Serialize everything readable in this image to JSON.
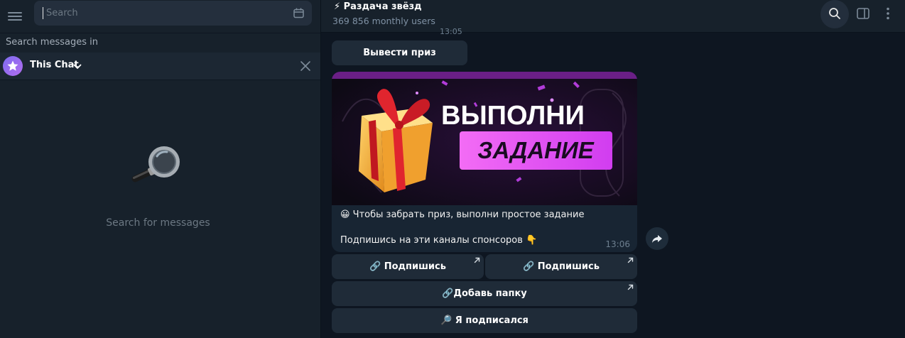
{
  "sidebar": {
    "search_placeholder": "Search",
    "search_in_label": "Search messages in",
    "scope_chip_label": "This Chat",
    "empty_text": "Search for messages"
  },
  "header": {
    "title": "⚡ Раздача звёзд",
    "subtitle": "369 856 monthly users"
  },
  "messages": {
    "prev_time": "13:05",
    "withdraw_button": "Вывести приз",
    "post": {
      "banner_title": "ВЫПОЛНИ",
      "banner_subtitle": "ЗАДАНИЕ",
      "line1": "😀 Чтобы забрать приз, выполни простое задание",
      "line2": "Подпишись на эти каналы спонсоров 👇",
      "time": "13:06"
    },
    "buttons": {
      "subscribe1": "🔗 Подпишись",
      "subscribe2": "🔗 Подпишись",
      "add_folder": "🔗Добавь папку",
      "subscribed": "🔎 Я подписался"
    }
  },
  "colors": {
    "app_bg": "#0e1621",
    "panel_bg": "#17212b",
    "bubble_bg": "#182533",
    "accent": "#7c6cf0",
    "banner_pink": "#e14bf0"
  },
  "icons": [
    "menu-icon",
    "calendar-icon",
    "star-icon",
    "chevron-down-icon",
    "close-icon",
    "magnifier-icon",
    "search-icon",
    "sidebar-panel-icon",
    "more-vertical-icon",
    "share-icon",
    "external-arrow-icon"
  ]
}
